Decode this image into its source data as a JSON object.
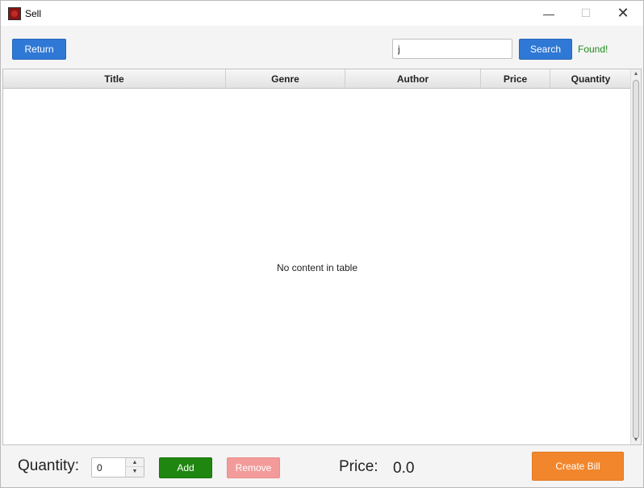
{
  "window": {
    "title": "Sell",
    "minimize_glyph": "—",
    "maximize_glyph": "☐",
    "close_glyph": "✕"
  },
  "toolbar": {
    "return_label": "Return",
    "search_value": "j",
    "search_label": "Search",
    "status_text": "Found!"
  },
  "table": {
    "columns": [
      "Title",
      "Genre",
      "Author",
      "Price",
      "Quantity"
    ],
    "empty_message": "No content in table",
    "rows": []
  },
  "bottom": {
    "quantity_label": "Quantity:",
    "quantity_value": "0",
    "add_label": "Add",
    "remove_label": "Remove",
    "price_label": "Price:",
    "price_value": "0.0",
    "create_bill_label": "Create Bill"
  },
  "colors": {
    "primary_blue": "#2f78d5",
    "add_green": "#1f860f",
    "remove_pink": "#f39b9b",
    "bill_orange": "#f2862d",
    "status_green": "#1d8a1d"
  }
}
